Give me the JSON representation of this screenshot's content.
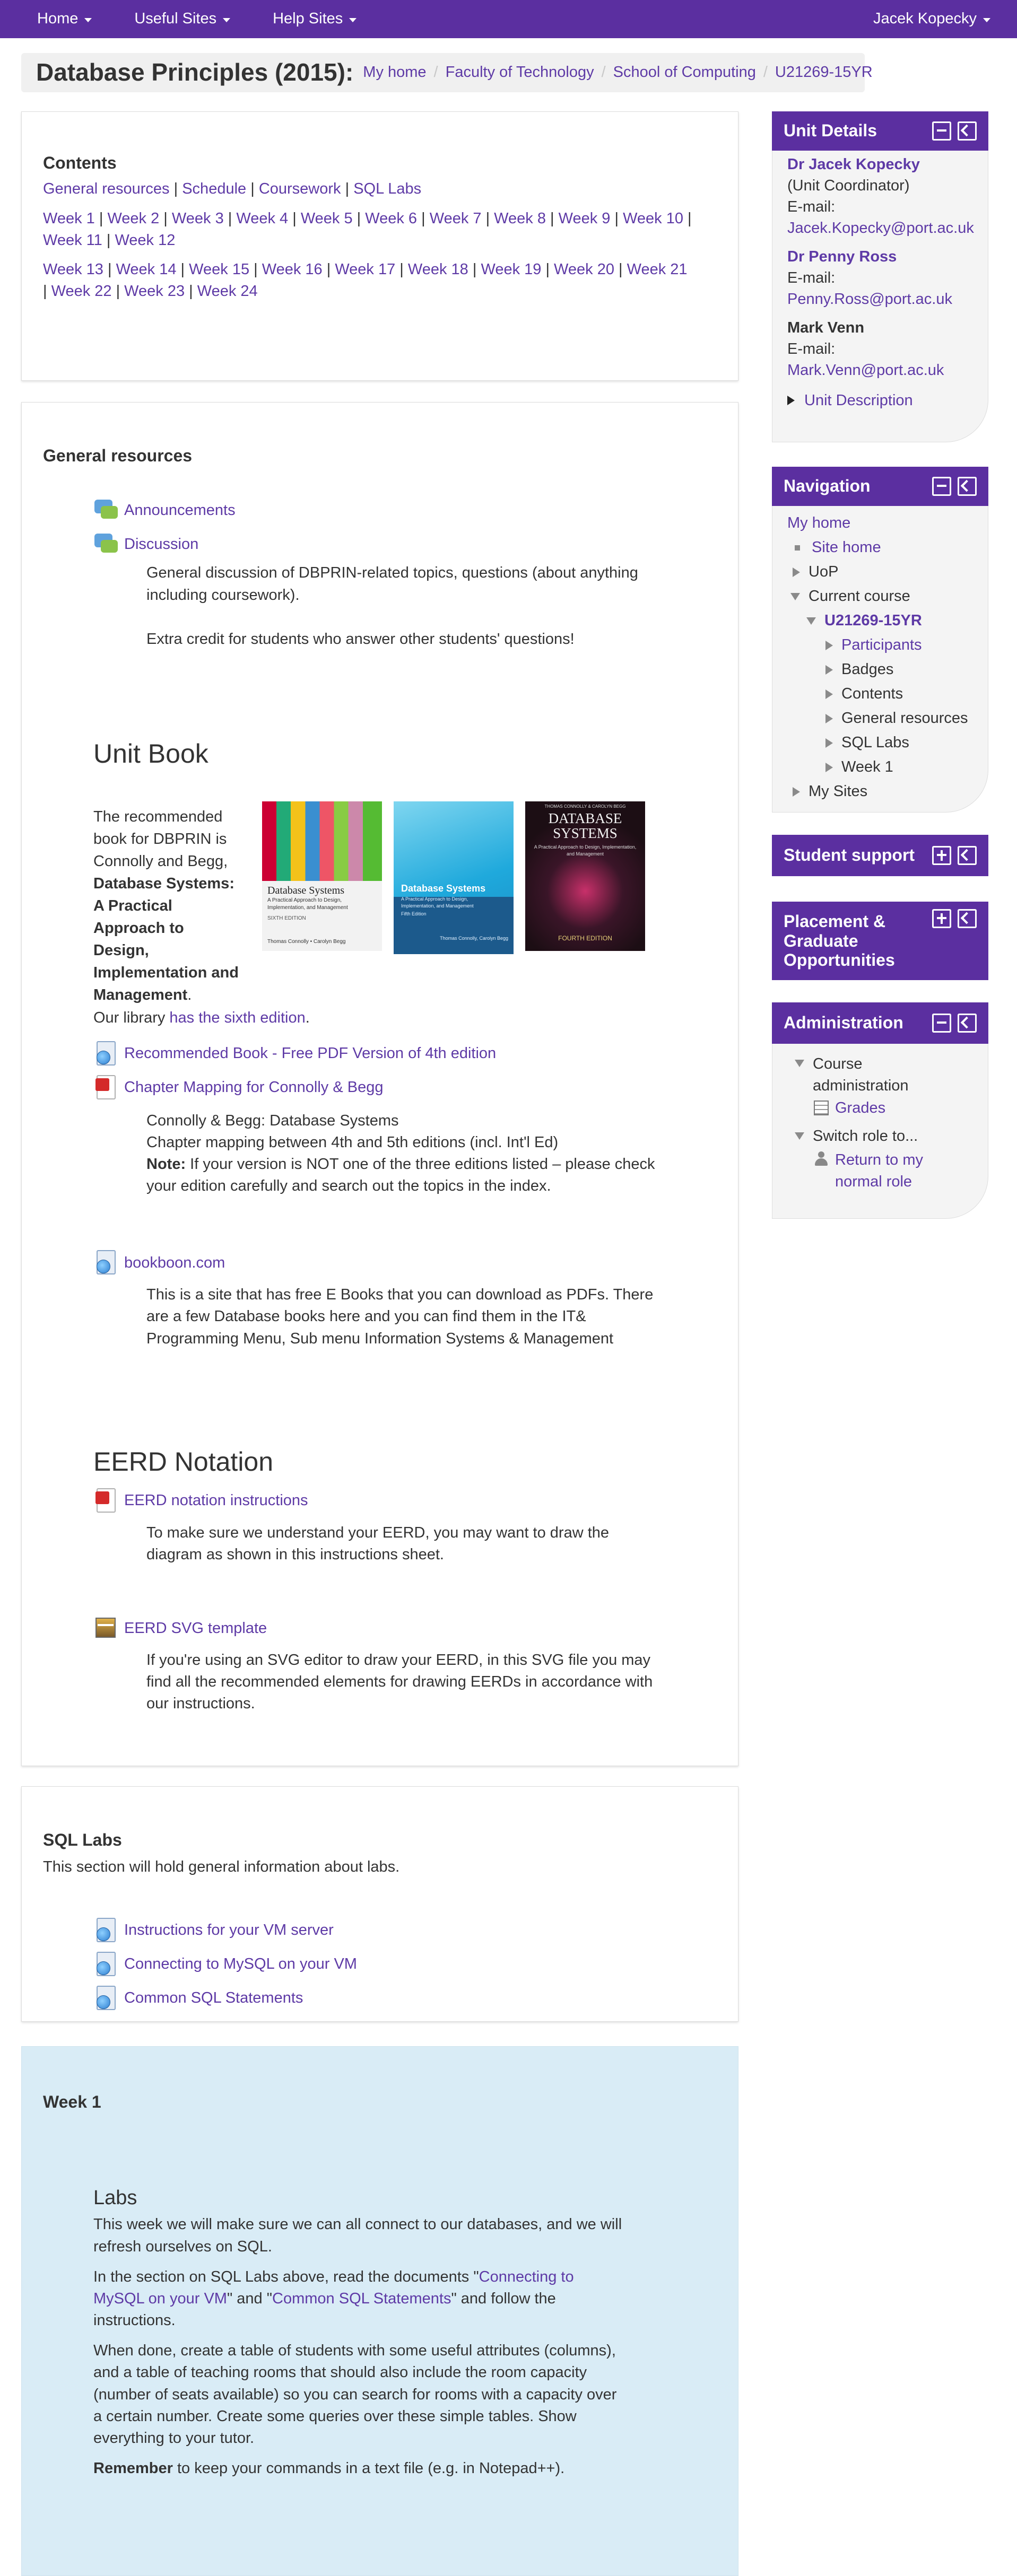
{
  "navbar": {
    "items": [
      "Home",
      "Useful Sites",
      "Help Sites"
    ],
    "user": "Jacek Kopecky",
    "background": "#5b2fa0"
  },
  "header": {
    "title": "Database Principles (2015):",
    "breadcrumb": [
      "My home",
      "Faculty of Technology",
      "School of Computing",
      "U21269-15YR"
    ]
  },
  "contents": {
    "title": "Contents",
    "links1": [
      "General resources",
      "Schedule",
      "Coursework",
      "SQL Labs"
    ],
    "weeks_a": [
      "Week 1",
      "Week 2",
      "Week 3",
      "Week 4",
      "Week 5",
      "Week 6",
      "Week 7",
      "Week 8",
      "Week 9",
      "Week 10",
      "Week 11",
      "Week 12"
    ],
    "weeks_b": [
      "Week 13",
      "Week 14",
      "Week 15",
      "Week 16",
      "Week 17",
      "Week 18",
      "Week 19",
      "Week 20",
      "Week 21",
      "Week 22",
      "Week 23",
      "Week 24"
    ]
  },
  "general": {
    "title": "General resources",
    "announcements": "Announcements",
    "discussion": "Discussion",
    "discussion_desc1": "General discussion of DBPRIN-related topics, questions (about anything including coursework).",
    "discussion_desc2": "Extra credit for students who answer other students' questions!",
    "unit_book_heading": "Unit Book",
    "book_intro": "The recommended book for DBPRIN is Connolly and Begg,",
    "book_title": "Database Systems: A Practical Approach to Design, Implementation and Management",
    "book_title_end": ".",
    "library_prefix": "Our library ",
    "library_link": "has the sixth edition",
    "library_suffix": ".",
    "pdf_link": "Recommended Book - Free PDF Version of 4th edition",
    "chapter_link": "Chapter Mapping for Connolly & Begg",
    "chapter_desc1": "Connolly & Begg: Database Systems",
    "chapter_desc2": "Chapter mapping between 4th and 5th editions (incl. Int'l Ed)",
    "note_label": "Note:",
    "note_text": " If your version is NOT one of the three editions listed – please check your edition carefully and search out the topics in the index.",
    "bookboon_link": "bookboon.com",
    "bookboon_desc": "This is a site that has free E Books that you can download as PDFs. There are a few Database books here and you can find them in the IT& Programming Menu, Sub menu Information Systems & Management",
    "eerd_heading": "EERD Notation",
    "eerd_link": "EERD notation instructions",
    "eerd_desc": "To make sure we understand your EERD, you may want to draw the diagram as shown in this instructions sheet.",
    "svg_link": "EERD SVG template",
    "svg_desc": "If you're using an SVG editor to draw your EERD, in this SVG file you may find all the recommended elements for drawing EERDs in accordance with our instructions."
  },
  "covers": [
    {
      "title": "Database Systems",
      "subtitle": "A Practical Approach to Design, Implementation, and Management",
      "edition": "SIXTH EDITION",
      "authors": "Thomas Connolly • Carolyn Begg"
    },
    {
      "title": "Database Systems",
      "subtitle": "A Practical Approach to Design, Implementation, and Management",
      "edition": "Fifth Edition",
      "authors": "Thomas Connolly, Carolyn Begg"
    },
    {
      "title": "DATABASE SYSTEMS",
      "subtitle": "A Practical Approach to Design, Implementation, and Management",
      "edition": "FOURTH EDITION",
      "authors": "THOMAS CONNOLLY & CAROLYN BEGG"
    }
  ],
  "sqllabs": {
    "title": "SQL Labs",
    "desc": "This section will hold general information about labs.",
    "links": [
      "Instructions for your VM server",
      "Connecting to MySQL on your VM",
      "Common SQL Statements"
    ]
  },
  "week1": {
    "title": "Week 1",
    "labs_heading": "Labs",
    "p1": "This week we will make sure we can all connect to our databases, and we will refresh ourselves on SQL.",
    "p2_a": "In the section on SQL Labs above, read the documents \"",
    "p2_link1": "Connecting to MySQL on your VM",
    "p2_b": "\" and \"",
    "p2_link2": "Common SQL Statements",
    "p2_c": "\" and follow the instructions.",
    "p3": "When done, create a table of students with some useful attributes (columns), and a table of teaching rooms that should also include the room capacity (number of seats available) so you can search for rooms with a capacity over a certain number. Create some queries over these simple tables. Show everything to your tutor.",
    "p4_bold": "Remember",
    "p4_rest": " to keep your commands in a text file (e.g. in Notepad++)."
  },
  "unit_details": {
    "title": "Unit Details",
    "p1_name": "Dr Jacek Kopecky",
    "p1_role": "(Unit Coordinator)",
    "p1_email_label": "E-mail:",
    "p1_email": "Jacek.Kopecky@port.ac.uk",
    "p2_name": "Dr Penny Ross",
    "p2_email_label": "E-mail:",
    "p2_email": "Penny.Ross@port.ac.uk",
    "p3_name": "Mark Venn",
    "p3_email_label": "E-mail:",
    "p3_email": "Mark.Venn@port.ac.uk",
    "unit_desc": "Unit Description"
  },
  "navigation": {
    "title": "Navigation",
    "my_home": "My home",
    "site_home": "Site home",
    "uop": "UoP",
    "current_course": "Current course",
    "course": "U21269-15YR",
    "items": [
      "Participants",
      "Badges",
      "Contents",
      "General resources",
      "SQL Labs",
      "Week 1"
    ],
    "my_sites": "My Sites"
  },
  "student_support": {
    "title": "Student support"
  },
  "placement": {
    "title": "Placement & Graduate Opportunities"
  },
  "administration": {
    "title": "Administration",
    "course_admin": "Course administration",
    "grades": "Grades",
    "switch_role": "Switch role to...",
    "return_role": "Return to my normal role"
  },
  "colors": {
    "brand": "#5b2fa0",
    "link": "#5e3aa6",
    "week_bg": "#d9ecf6"
  }
}
